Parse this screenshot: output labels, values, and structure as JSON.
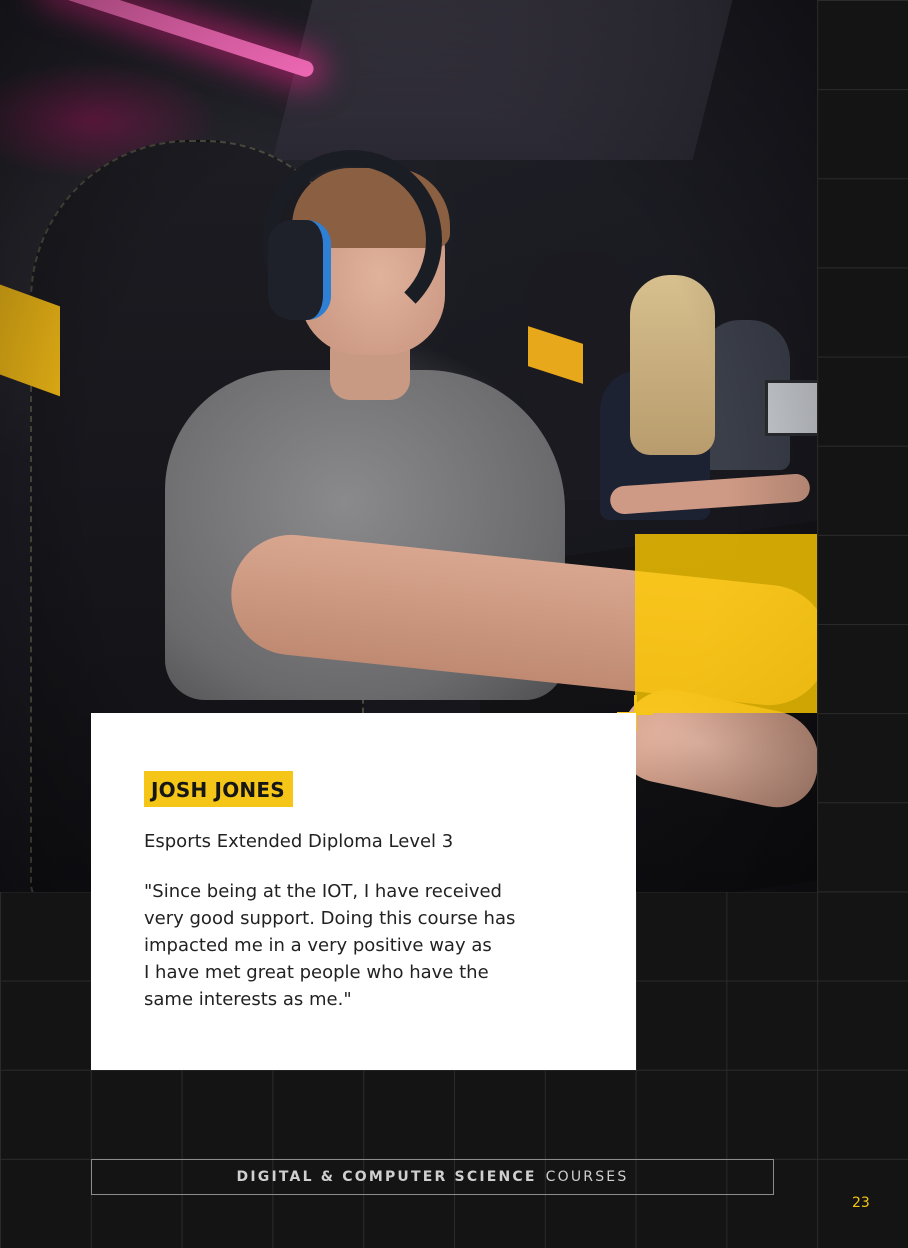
{
  "testimonial": {
    "name": "JOSH JONES",
    "course": "Esports Extended Diploma Level 3",
    "quote": "\"Since being at the IOT, I have received\nvery good support. Doing this course has\nimpacted me in a very positive way as\nI have met great people who have the\nsame interests as me.\""
  },
  "footer": {
    "bold_text": "DIGITAL & COMPUTER SCIENCE",
    "light_text": "COURSES"
  },
  "page_number": "23",
  "colors": {
    "accent_yellow": "#f5c518",
    "background": "#141414",
    "card": "#ffffff"
  }
}
